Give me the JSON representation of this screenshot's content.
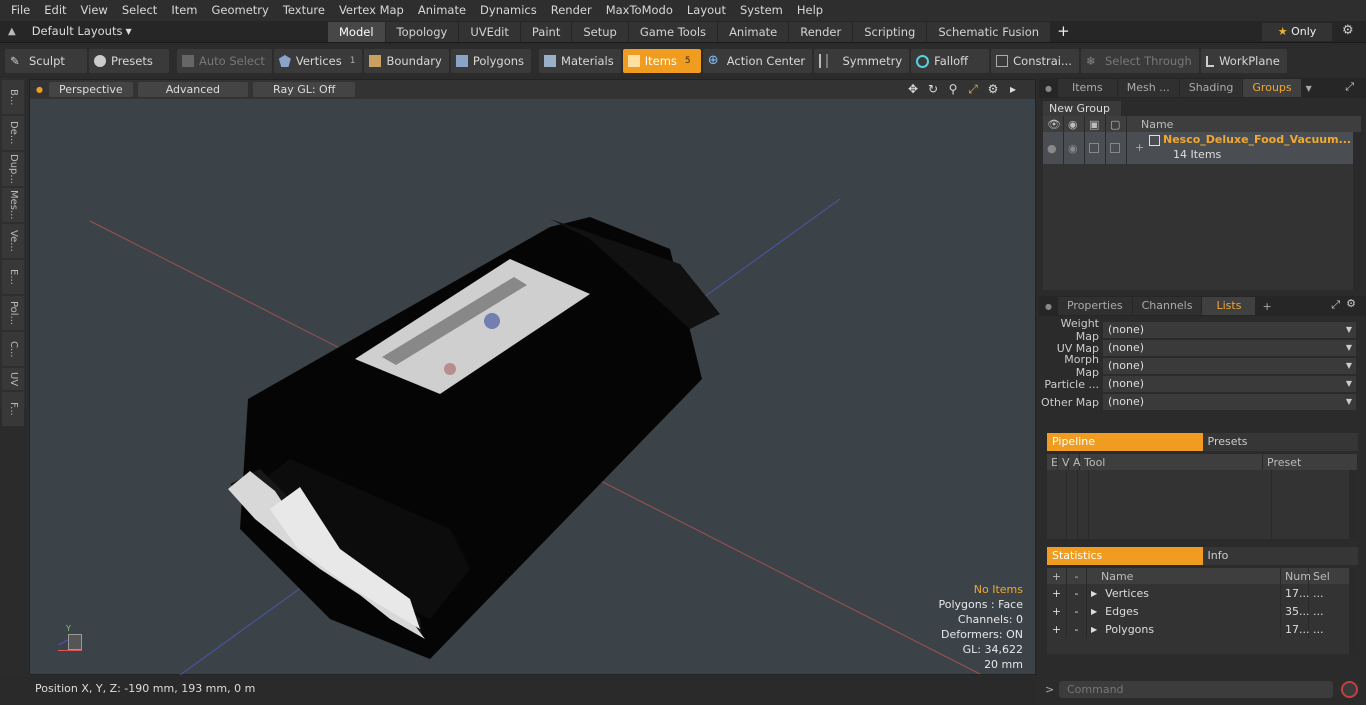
{
  "menu": [
    "File",
    "Edit",
    "View",
    "Select",
    "Item",
    "Geometry",
    "Texture",
    "Vertex Map",
    "Animate",
    "Dynamics",
    "Render",
    "MaxToModo",
    "Layout",
    "System",
    "Help"
  ],
  "layouts_label": "Default Layouts",
  "main_tabs": [
    "Model",
    "Topology",
    "UVEdit",
    "Paint",
    "Setup",
    "Game Tools",
    "Animate",
    "Render",
    "Scripting",
    "Schematic Fusion"
  ],
  "active_main_tab": "Model",
  "only_label": "Only",
  "toolbar": {
    "sculpt": "Sculpt",
    "presets": "Presets",
    "auto_select": "Auto Select",
    "vertices": "Vertices",
    "vertices_count": "1",
    "boundary": "Boundary",
    "polygons": "Polygons",
    "materials": "Materials",
    "items": "Items",
    "items_count": "5",
    "action_center": "Action Center",
    "symmetry": "Symmetry",
    "falloff": "Falloff",
    "constraints": "Constrai...",
    "select_through": "Select Through",
    "workplane": "WorkPlane"
  },
  "left_tools": [
    "B...",
    "De...",
    "Dup...",
    "Mes...",
    "Ve...",
    "E...",
    "Pol...",
    "C...",
    "UV",
    "F..."
  ],
  "viewport": {
    "perspective": "Perspective",
    "advanced": "Advanced",
    "raygl": "Ray GL: Off",
    "hud": {
      "no_items": "No Items",
      "polygons": "Polygons : Face",
      "channels": "Channels: 0",
      "deformers": "Deformers: ON",
      "gl": "GL: 34,622",
      "scale": "20 mm"
    }
  },
  "status": "Position X, Y, Z:  -190 mm, 193 mm, 0 m",
  "groups_panel": {
    "tabs": [
      "Items",
      "Mesh ...",
      "Shading",
      "Groups"
    ],
    "active": "Groups",
    "new_group": "New Group",
    "name_header": "Name",
    "group_name": "Nesco_Deluxe_Food_Vacuum...",
    "group_count": "14 Items"
  },
  "props_panel": {
    "tabs": [
      "Properties",
      "Channels",
      "Lists"
    ],
    "active": "Lists",
    "maps": [
      {
        "label": "Weight Map",
        "value": "(none)"
      },
      {
        "label": "UV Map",
        "value": "(none)"
      },
      {
        "label": "Morph Map",
        "value": "(none)"
      },
      {
        "label": "Particle  ...",
        "value": "(none)"
      },
      {
        "label": "Other Map",
        "value": "(none)"
      }
    ]
  },
  "pipeline": {
    "tab_on": "Pipeline",
    "tab_off": "Presets",
    "cols": [
      "E",
      "V",
      "A",
      "Tool",
      "Preset"
    ]
  },
  "statistics": {
    "tab_on": "Statistics",
    "tab_off": "Info",
    "cols": [
      "+",
      "-",
      "Name",
      "Num",
      "Sel"
    ],
    "rows": [
      {
        "name": "Vertices",
        "num": "17...",
        "sel": "..."
      },
      {
        "name": "Edges",
        "num": "35...",
        "sel": "..."
      },
      {
        "name": "Polygons",
        "num": "17...",
        "sel": "..."
      }
    ]
  },
  "command_placeholder": "Command",
  "colors": {
    "accent": "#f09c20",
    "viewport_bg": "#3b4348"
  }
}
